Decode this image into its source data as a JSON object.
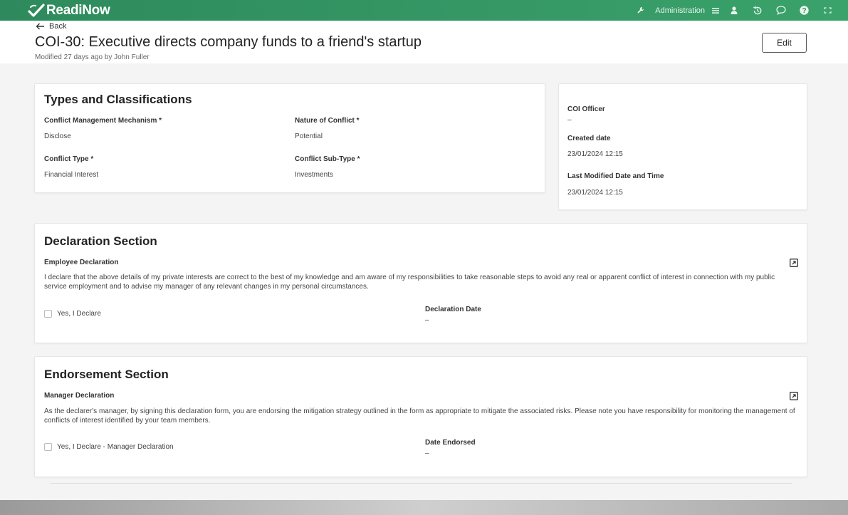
{
  "app": {
    "brand": "ReadiNow",
    "brand_color": "#2e8a5c"
  },
  "topbar": {
    "icons": [
      "wrench-icon",
      "hamburger-menu-icon",
      "user-icon",
      "history-icon",
      "chat-icon",
      "help-icon",
      "expand-icon"
    ],
    "admin_label": "Administration"
  },
  "header": {
    "back_label": "Back",
    "title": "COI-30: Executive directs company funds to a friend's startup",
    "modified": "Modified 27 days ago by John Fuller",
    "edit_label": "Edit"
  },
  "types": {
    "heading": "Types and Classifications",
    "fields": [
      {
        "label": "Conflict Management Mechanism *",
        "value": "Disclose"
      },
      {
        "label": "Nature of Conflict *",
        "value": "Potential"
      },
      {
        "label": "Conflict Type *",
        "value": "Financial Interest"
      },
      {
        "label": "Conflict Sub-Type *",
        "value": "Investments"
      }
    ]
  },
  "side": {
    "fields": [
      {
        "label": "COI Officer",
        "value": "–"
      },
      {
        "label": "Created date",
        "value": "23/01/2024 12:15"
      },
      {
        "label": "Last Modified Date and Time",
        "value": "23/01/2024 12:15"
      }
    ]
  },
  "declaration": {
    "heading": "Declaration Section",
    "sub_label": "Employee Declaration",
    "text": "I declare that the above details of my private interests are correct to the best of my knowledge and am aware of my responsibilities to take reasonable steps to avoid any real or apparent conflict of interest in connection with my public service employment and to advise my manager of any relevant changes in my personal circumstances.",
    "checkbox_label": "Yes, I Declare",
    "checked": false,
    "date_label": "Declaration Date",
    "date_value": "–"
  },
  "endorsement": {
    "heading": "Endorsement Section",
    "sub_label": "Manager Declaration",
    "text": "As the declarer's manager, by signing this declaration form, you are endorsing the mitigation strategy outlined in the form as appropriate to mitigate the associated risks. Please note you have responsibility for monitoring the management of conflicts of interest identified by your team members.",
    "checkbox_label": "Yes, I Declare - Manager Declaration",
    "checked": false,
    "date_label": "Date Endorsed",
    "date_value": "–"
  }
}
